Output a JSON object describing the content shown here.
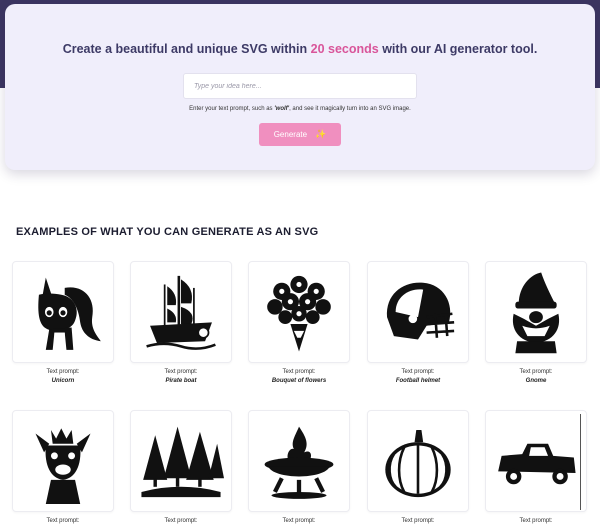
{
  "hero": {
    "title_before": "Create a beautiful and unique SVG within ",
    "title_accent": "20 seconds",
    "title_after": " with our AI generator tool.",
    "input_placeholder": "Type your idea here...",
    "input_value": "",
    "hint_before": "Enter your text prompt, such as ",
    "hint_example": "'wolf'",
    "hint_after": ", and see it magically turn into an SVG image.",
    "generate_label": "Generate",
    "generate_icon": "sparkle-icon"
  },
  "examples": {
    "title": "EXAMPLES OF WHAT YOU CAN GENERATE AS AN SVG",
    "prompt_label": "Text prompt:",
    "items": [
      {
        "name": "Unicorn",
        "icon": "unicorn-image"
      },
      {
        "name": "Pirate boat",
        "icon": "pirate-boat-image"
      },
      {
        "name": "Bouquet of flowers",
        "icon": "bouquet-image"
      },
      {
        "name": "Football helmet",
        "icon": "football-helmet-image"
      },
      {
        "name": "Gnome",
        "icon": "gnome-image"
      },
      {
        "name": "",
        "icon": "llama-image"
      },
      {
        "name": "",
        "icon": "pine-trees-image"
      },
      {
        "name": "",
        "icon": "fire-pit-image"
      },
      {
        "name": "",
        "icon": "pumpkin-image"
      },
      {
        "name": "",
        "icon": "pickup-truck-image"
      }
    ]
  },
  "colors": {
    "header_band": "#3c3561",
    "hero_bg": "#f0eefb",
    "title_text": "#3d3a66",
    "accent": "#d9559a",
    "button": "#f08fbf"
  }
}
